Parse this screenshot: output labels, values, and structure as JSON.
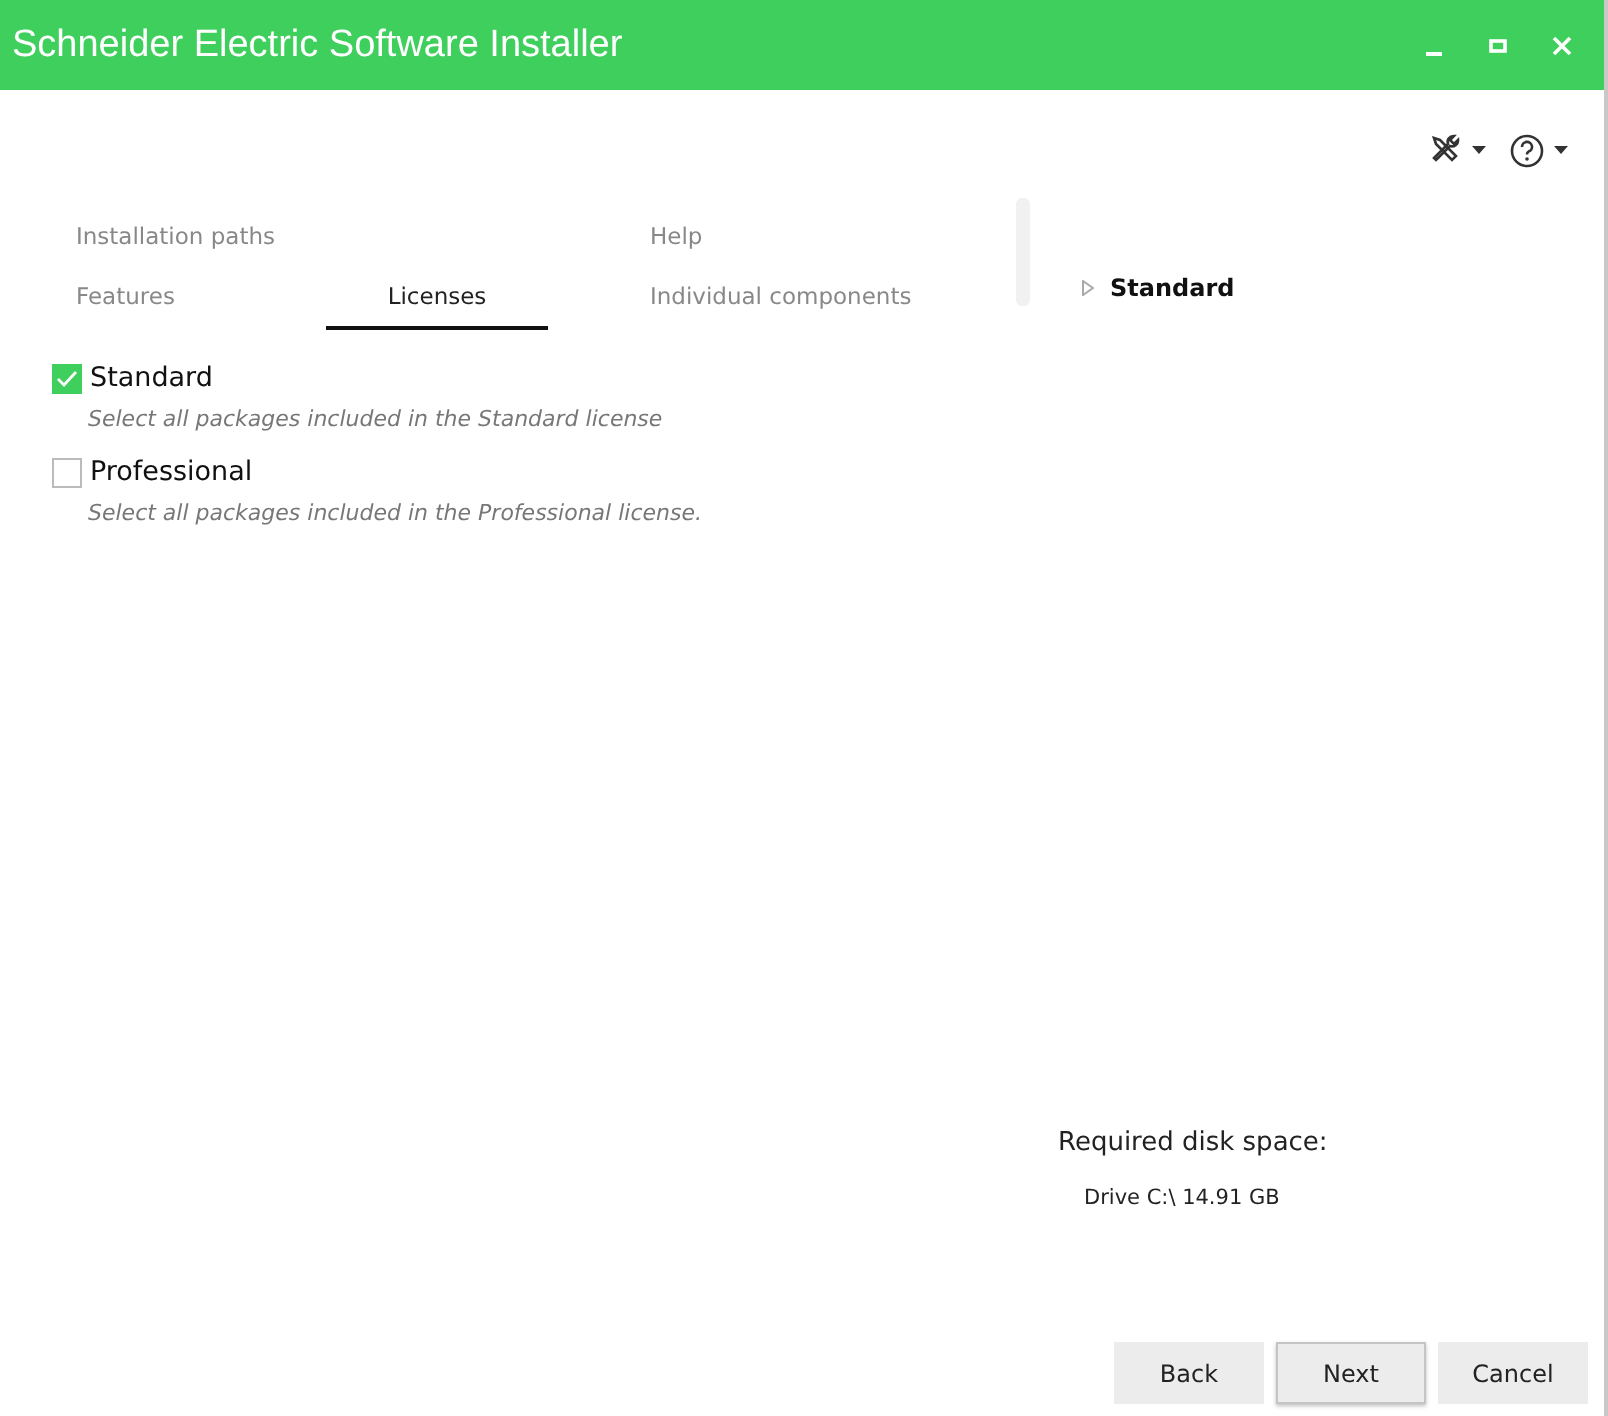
{
  "window": {
    "title": "Schneider Electric Software Installer",
    "controls": [
      {
        "kind": "minimize"
      },
      {
        "kind": "maximize"
      },
      {
        "kind": "close"
      }
    ]
  },
  "toolbar": [
    {
      "kind": "tools"
    },
    {
      "kind": "help"
    }
  ],
  "tab_rows": [
    [
      {
        "label": "Installation paths",
        "selected": false
      },
      {
        "label": "Help",
        "selected": false
      }
    ],
    [
      {
        "label": "Features",
        "selected": false
      },
      {
        "label": "Licenses",
        "selected": true
      },
      {
        "label": "Individual components",
        "selected": false
      }
    ]
  ],
  "licenses": [
    {
      "name": "Standard",
      "checked": true,
      "description": "Select all packages included in the Standard license"
    },
    {
      "name": "Professional",
      "checked": false,
      "description": "Select all packages included in the Professional license."
    }
  ],
  "tree": [
    {
      "label": "Standard",
      "expanded": false
    }
  ],
  "disk_space": {
    "label": "Required disk space:",
    "drives": [
      "Drive C:\\ 14.91 GB"
    ]
  },
  "buttons": [
    {
      "label": "Back",
      "selected": false
    },
    {
      "label": "Next",
      "selected": true
    },
    {
      "label": "Cancel",
      "selected": false
    }
  ]
}
